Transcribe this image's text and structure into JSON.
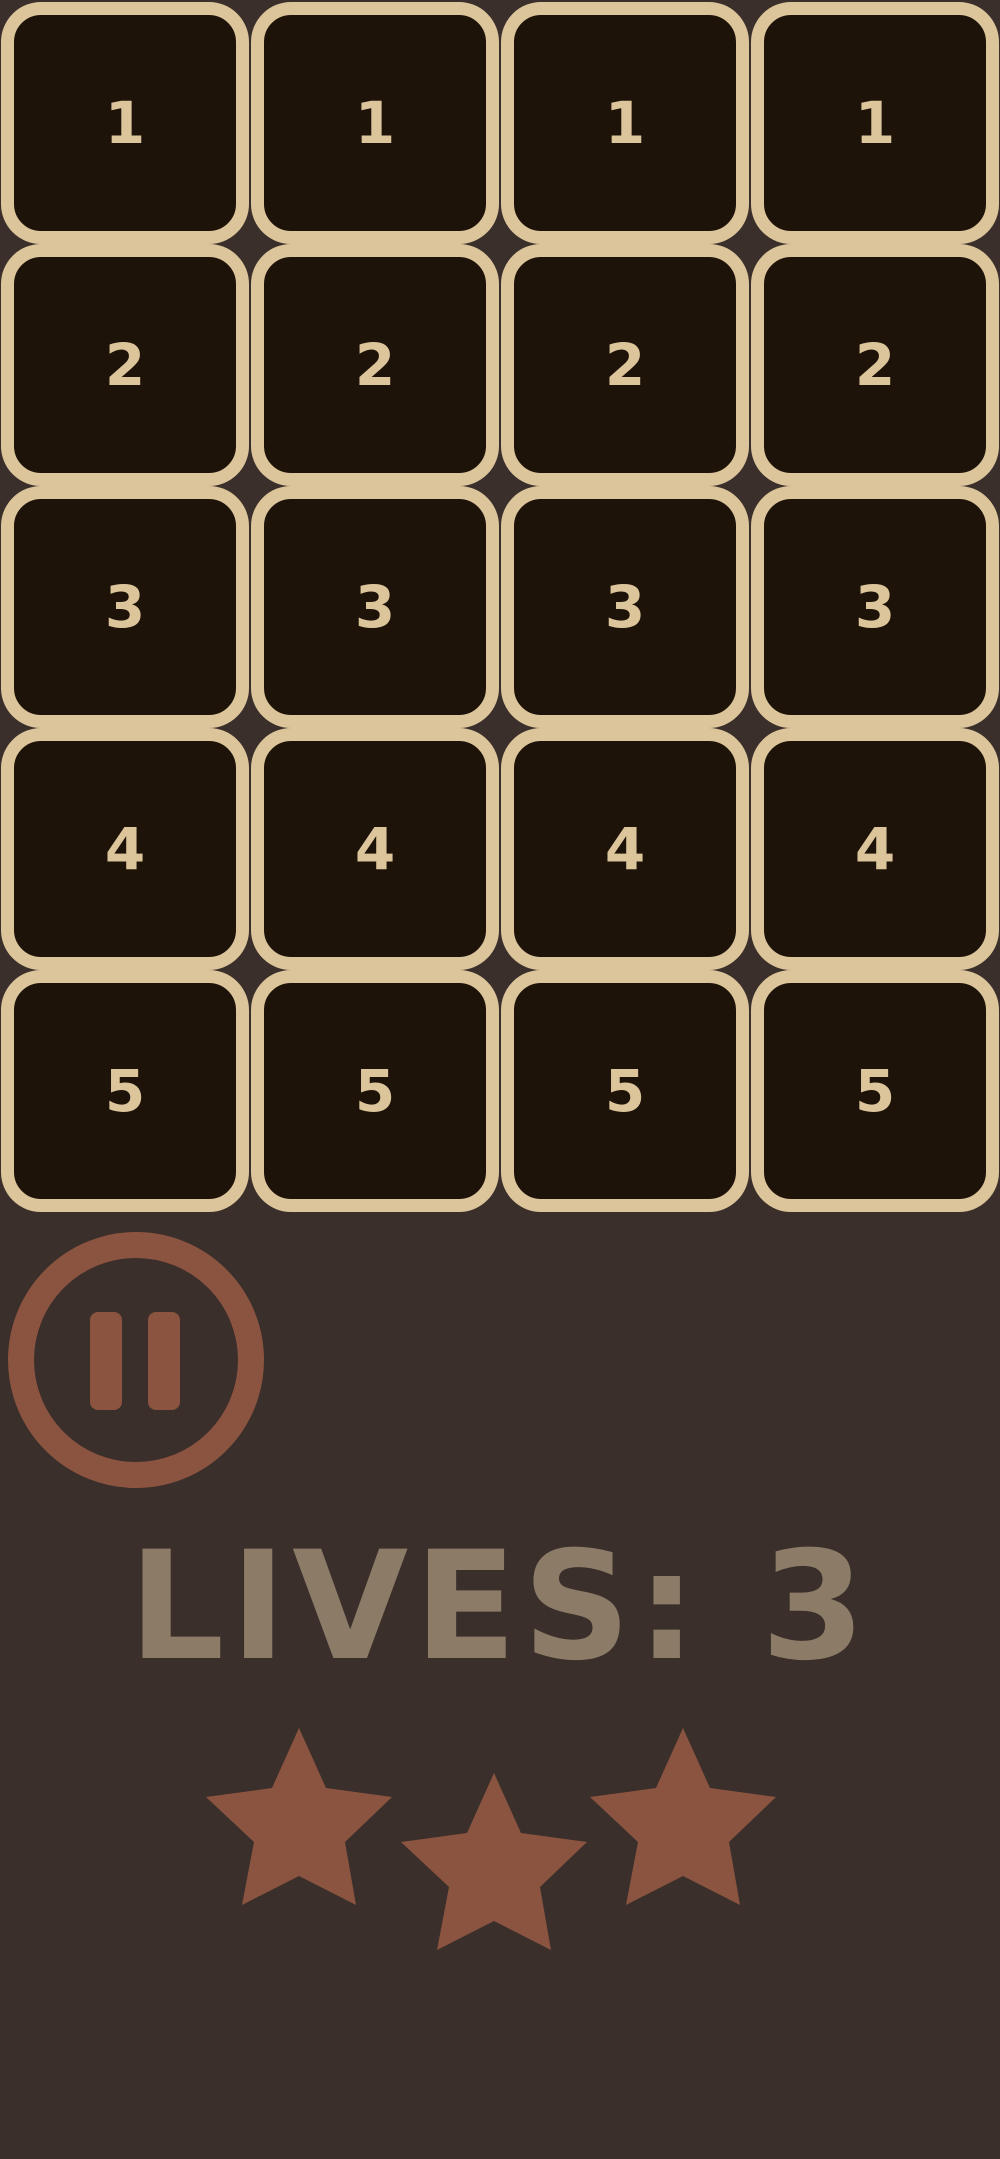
{
  "board": {
    "rows": [
      [
        "1",
        "1",
        "1",
        "1"
      ],
      [
        "2",
        "2",
        "2",
        "2"
      ],
      [
        "3",
        "3",
        "3",
        "3"
      ],
      [
        "4",
        "4",
        "4",
        "4"
      ],
      [
        "5",
        "5",
        "5",
        "5"
      ]
    ]
  },
  "pause": {
    "icon": "pause-icon"
  },
  "status": {
    "lives_label": "LIVES: 3",
    "lives": 3,
    "stars_earned": 3
  },
  "colors": {
    "background": "#3a2f2a",
    "tile_fill": "#1e1309",
    "tile_border": "#dcc59b",
    "tile_text": "#dcc59b",
    "accent": "#8b5440",
    "lives_text": "#8b7b67"
  }
}
